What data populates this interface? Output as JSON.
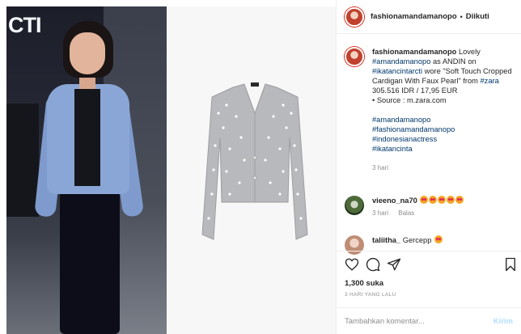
{
  "media": {
    "left_logo": "CTI"
  },
  "header": {
    "username": "fashionamandamanopo",
    "separator": "•",
    "follow_status": "Diikuti"
  },
  "caption": {
    "username": "fashionamandamanopo",
    "line1_text": " Lovely ",
    "tag1": "#amandamanopo",
    "line2_text": " as ANDIN on ",
    "tag2": "#ikatancintarcti",
    "line3_text": " wore \"Soft Touch Cropped Cardigan With Faux Pearl\" from ",
    "tag3": "#zara",
    "price": "305.516 IDR / 17,95 EUR",
    "source": "• Source : m.zara.com",
    "hashtags": [
      "#amandamanopo",
      "#fashionamandamanopo",
      "#indonesianactress",
      "#ikatancinta"
    ],
    "time": "3 hari"
  },
  "comments": [
    {
      "username": "vieeno_na70",
      "emoji_count": 5,
      "time": "3 hari",
      "reply": "Balas"
    },
    {
      "username": "taliitha_",
      "text": "Gercepp",
      "emoji_count": 1
    }
  ],
  "actions": {
    "like_icon": "heart-icon",
    "comment_icon": "comment-icon",
    "share_icon": "share-icon",
    "save_icon": "bookmark-icon"
  },
  "likes": "1,300 suka",
  "post_time": "3 HARI YANG LALU",
  "comment_box": {
    "placeholder": "Tambahkan komentar...",
    "post_label": "Kirim"
  },
  "colors": {
    "link": "#00376b",
    "muted": "#8e8e8e",
    "post_button_disabled": "#b2dffc"
  }
}
